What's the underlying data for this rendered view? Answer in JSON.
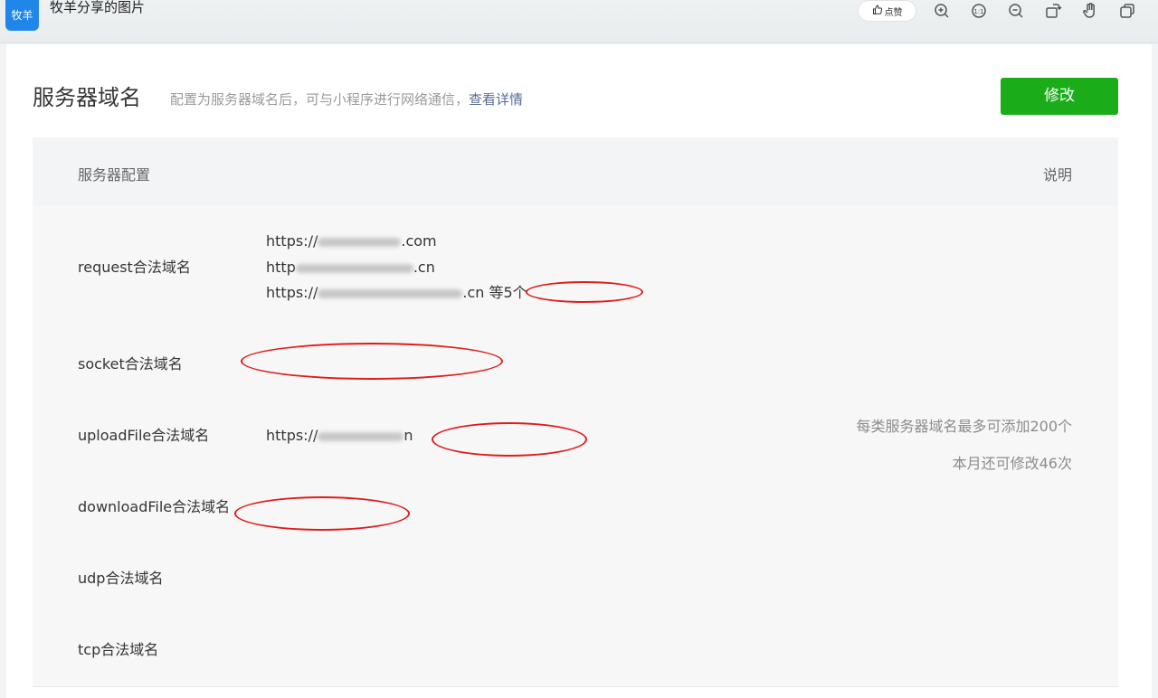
{
  "viewer": {
    "app_badge": "牧羊",
    "title": "牧羊分享的图片",
    "like_label": "点赞",
    "tools": [
      "zoom-in-icon",
      "actual-size-icon",
      "zoom-out-icon",
      "rotate-icon",
      "hand-icon",
      "copy-icon"
    ]
  },
  "page": {
    "title": "服务器域名",
    "description": "配置为服务器域名后，可与小程序进行网络通信，",
    "details_link": "查看详情",
    "edit_button": "修改",
    "table": {
      "col_config": "服务器配置",
      "col_note": "说明",
      "rows": [
        {
          "label": "request合法域名",
          "domains": [
            "https://",
            "http",
            "https://"
          ],
          "domain_suffixes": [
            ".com",
            ".cn",
            ".cn 等5个"
          ]
        },
        {
          "label": "socket合法域名"
        },
        {
          "label": "uploadFile合法域名",
          "domains": [
            "https://"
          ],
          "domain_suffixes": [
            "n"
          ]
        },
        {
          "label": "downloadFile合法域名"
        },
        {
          "label": "udp合法域名"
        },
        {
          "label": "tcp合法域名"
        }
      ],
      "notes": [
        "每类服务器域名最多可添加200个",
        "本月还可修改46次"
      ]
    }
  },
  "colors": {
    "primary_green": "#1aad19",
    "link_blue": "#576b95",
    "annotation_red": "#e11b1b",
    "badge_blue": "#1f87ea"
  }
}
